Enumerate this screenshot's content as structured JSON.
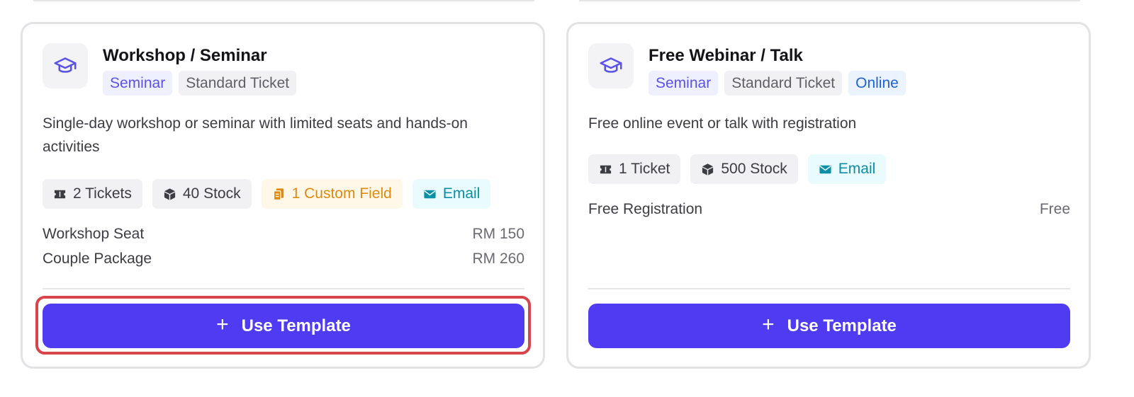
{
  "cards": [
    {
      "title": "Workshop / Seminar",
      "tags": [
        "Seminar",
        "Standard Ticket"
      ],
      "description": "Single-day workshop or seminar with limited seats and hands-on activities",
      "chips": {
        "tickets": "2 Tickets",
        "stock": "40 Stock",
        "custom_field": "1 Custom Field",
        "email": "Email"
      },
      "prices": [
        {
          "name": "Workshop Seat",
          "amount": "RM 150"
        },
        {
          "name": "Couple Package",
          "amount": "RM 260"
        }
      ],
      "button_label": "Use Template",
      "icon": "graduation-cap-icon"
    },
    {
      "title": "Free Webinar / Talk",
      "tags": [
        "Seminar",
        "Standard Ticket",
        "Online"
      ],
      "description": "Free online event or talk with registration",
      "chips": {
        "tickets": "1 Ticket",
        "stock": "500 Stock",
        "email": "Email"
      },
      "prices": [
        {
          "name": "Free Registration",
          "amount": "Free"
        }
      ],
      "button_label": "Use Template",
      "icon": "graduation-cap-icon"
    }
  ],
  "colors": {
    "primary": "#4f3bf2",
    "highlight": "#d9434c",
    "seminar_tag": "#5b52e6",
    "online_tag": "#1f62d8",
    "custom_field": "#df8a0e",
    "email": "#0b8ea6"
  }
}
